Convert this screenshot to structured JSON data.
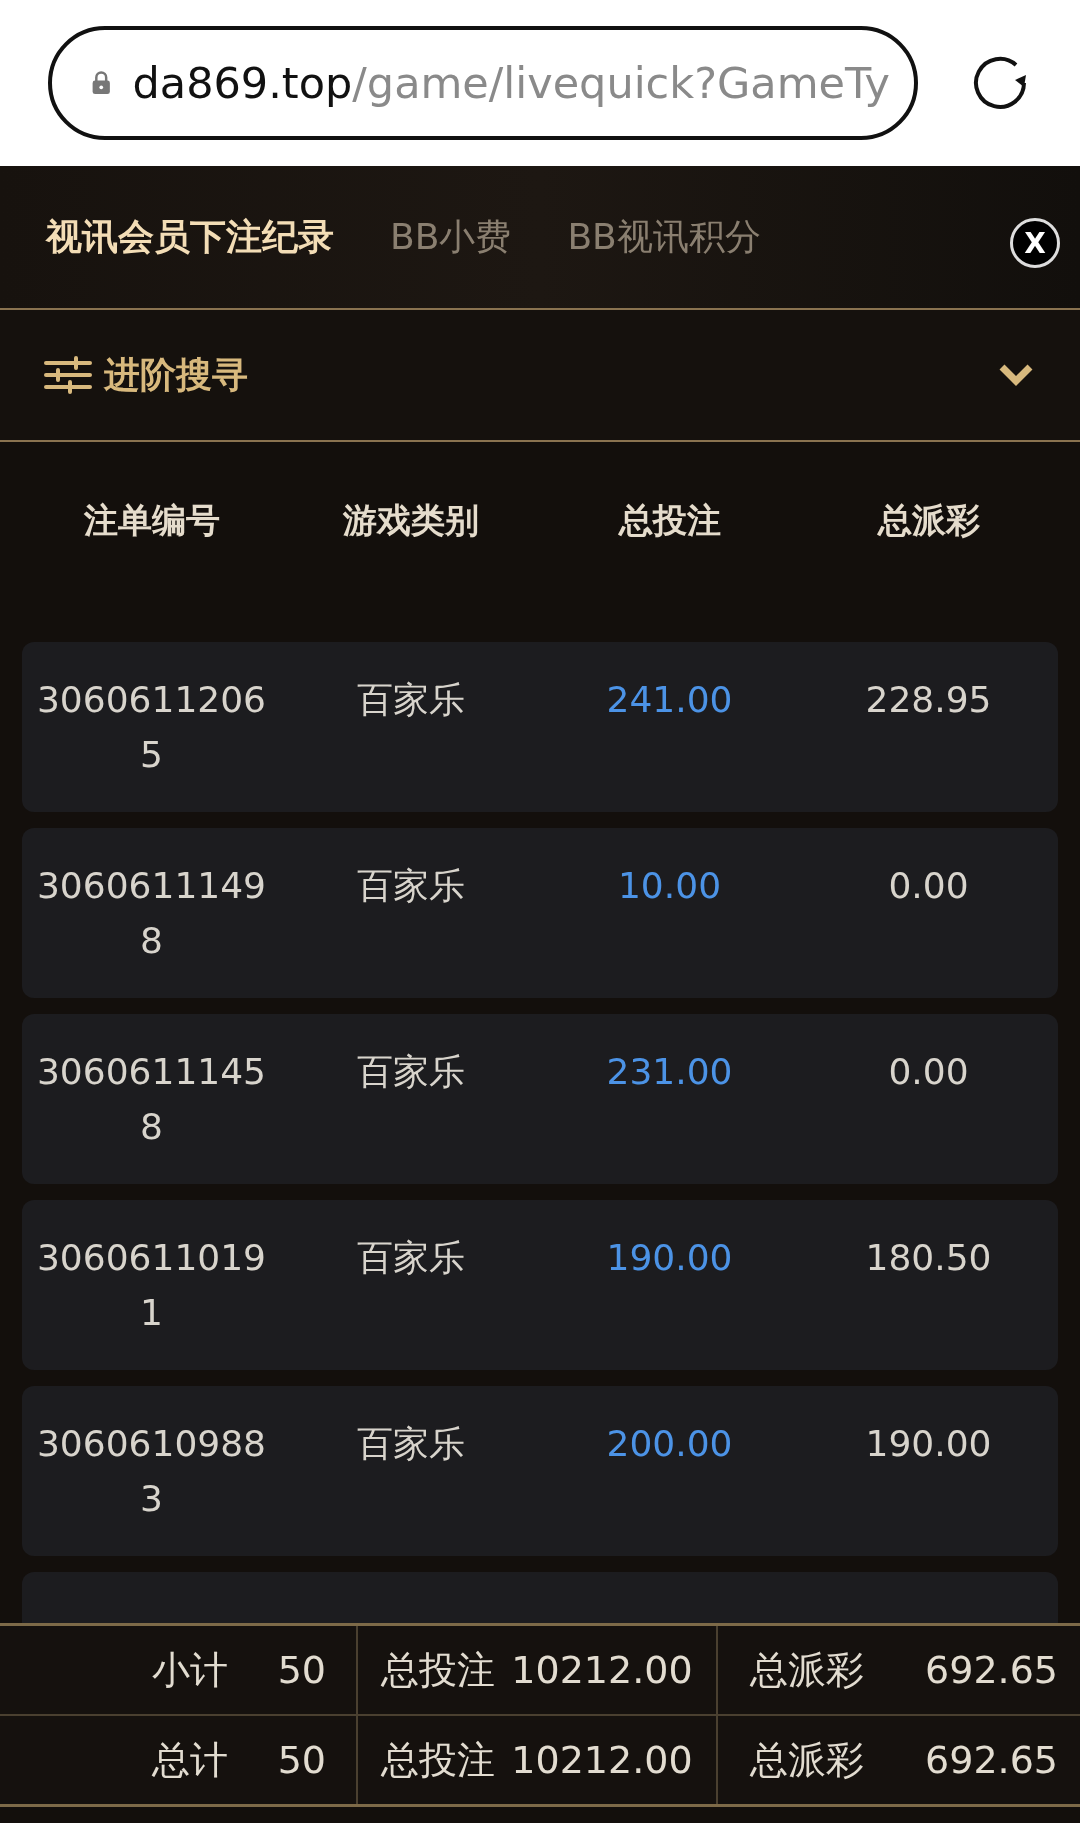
{
  "address_bar": {
    "host": "da869.top",
    "path": "/game/livequick?GameTy"
  },
  "tabs": [
    {
      "label": "视讯会员下注纪录",
      "selected": true
    },
    {
      "label": "BB小费",
      "selected": false
    },
    {
      "label": "BB视讯积分",
      "selected": false
    }
  ],
  "close": "X",
  "advanced_search": {
    "label": "进阶搜寻",
    "expanded": false
  },
  "table": {
    "columns": [
      "注单编号",
      "游戏类别",
      "总投注",
      "总派彩"
    ],
    "rows": [
      {
        "id": "30606112065",
        "game": "百家乐",
        "bet": "241.00",
        "payout": "228.95"
      },
      {
        "id": "30606111498",
        "game": "百家乐",
        "bet": "10.00",
        "payout": "0.00"
      },
      {
        "id": "30606111458",
        "game": "百家乐",
        "bet": "231.00",
        "payout": "0.00"
      },
      {
        "id": "30606110191",
        "game": "百家乐",
        "bet": "190.00",
        "payout": "180.50"
      },
      {
        "id": "30606109883",
        "game": "百家乐",
        "bet": "200.00",
        "payout": "190.00"
      }
    ]
  },
  "summary": [
    {
      "label": "小计",
      "count": "50",
      "bet_label": "总投注",
      "bet": "10212.00",
      "payout_label": "总派彩",
      "payout": "692.65"
    },
    {
      "label": "总计",
      "count": "50",
      "bet_label": "总投注",
      "bet": "10212.00",
      "payout_label": "总派彩",
      "payout": "692.65"
    }
  ]
}
